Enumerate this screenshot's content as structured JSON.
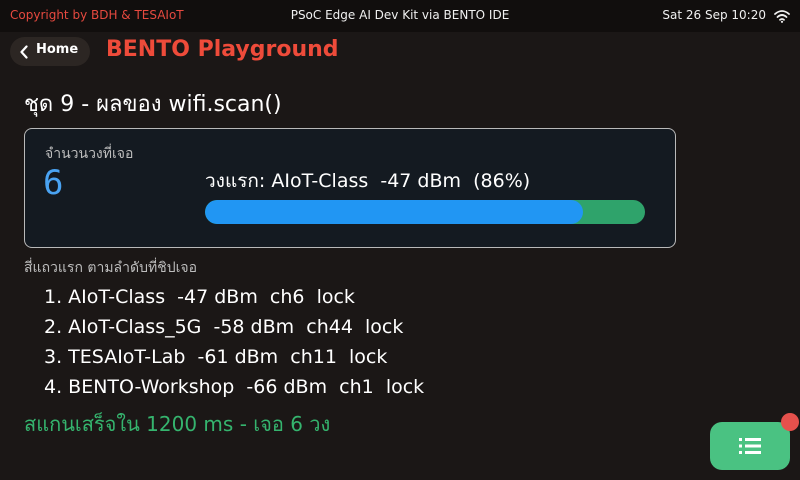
{
  "status_bar": {
    "copyright": "Copyright by BDH & TESAIoT",
    "center_text": "PSoC Edge AI Dev Kit via BENTO IDE",
    "datetime": "Sat 26 Sep 10:20",
    "wifi_icon": "wifi-icon"
  },
  "header": {
    "home_label": "Home",
    "home_icon": "chevron-left-icon",
    "app_title": "BENTO Playground"
  },
  "page": {
    "title": "ชุด 9 - ผลของ wifi.scan()"
  },
  "summary": {
    "count_label": "จำนวนวงที่เจอ",
    "count_value": "6",
    "first_network": "วงแรก: AIoT-Class  -47 dBm  (86%)",
    "signal_percent": 86
  },
  "list": {
    "caption": "สี่แถวแรก ตามลำดับที่ชิปเจอ",
    "items": [
      "1. AIoT-Class  -47 dBm  ch6  lock",
      "2. AIoT-Class_5G  -58 dBm  ch44  lock",
      "3. TESAIoT-Lab  -61 dBm  ch11  lock",
      "4. BENTO-Workshop  -66 dBm  ch1  lock"
    ]
  },
  "scan_result": "สแกนเสร็จใน 1200 ms - เจอ 6 วง",
  "fab": {
    "icon": "list-icon"
  },
  "colors": {
    "background": "#1b1716",
    "accent_red": "#ee4b3a",
    "accent_blue": "#2196f3",
    "accent_green": "#35b46e",
    "fab_green": "#4ac282",
    "badge_red": "#e5514c"
  }
}
